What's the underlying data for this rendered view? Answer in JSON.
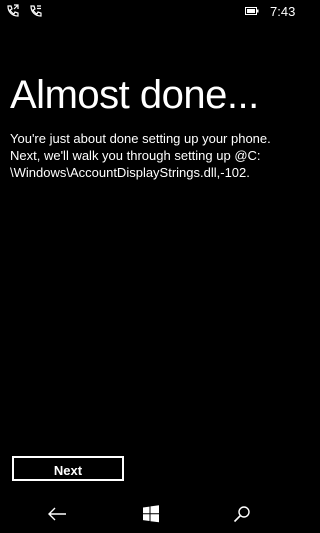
{
  "status_bar": {
    "time": "7:43",
    "icons": [
      "call-forward-icon",
      "voicemail-forward-icon",
      "battery-icon"
    ]
  },
  "page": {
    "title": "Almost done...",
    "body_lines": [
      "You're just about done setting up your phone.",
      "Next, we'll walk you through setting up @C:",
      "\\Windows\\AccountDisplayStrings.dll,-102."
    ]
  },
  "actions": {
    "next_label": "Next"
  },
  "nav_bar": {
    "buttons": [
      "back-icon",
      "windows-start-icon",
      "search-icon"
    ]
  },
  "colors": {
    "background": "#000000",
    "foreground": "#ffffff"
  }
}
